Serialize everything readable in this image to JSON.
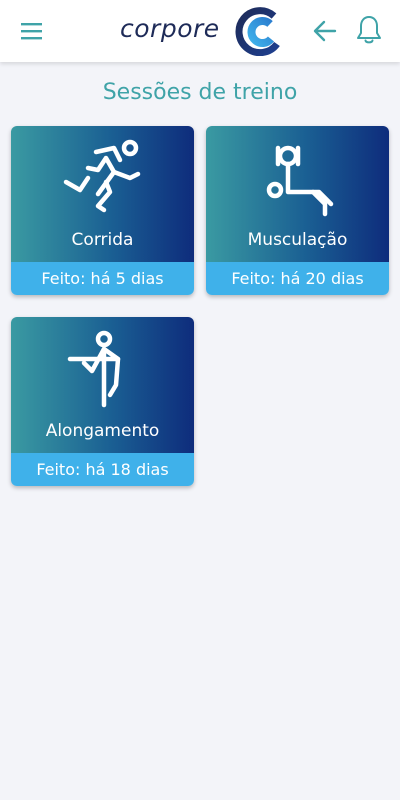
{
  "header": {
    "logo_text": "corpore",
    "menu_icon": "hamburger-menu-icon",
    "back_icon": "arrow-left-icon",
    "notification_icon": "bell-icon"
  },
  "colors": {
    "accent": "#3fa3a8",
    "brand_dark": "#1e2b58",
    "card_gradient_start": "#3a9aa2",
    "card_gradient_end": "#0e2c7c",
    "status_bar": "#3fb1ea",
    "background": "#f3f4f9"
  },
  "page": {
    "title": "Sessões de treino"
  },
  "sessions": [
    {
      "name": "Corrida",
      "status": "Feito: há 5 dias",
      "icon": "running-icon"
    },
    {
      "name": "Musculação",
      "status": "Feito: há 20 dias",
      "icon": "weightlifting-icon"
    },
    {
      "name": "Alongamento",
      "status": "Feito: há 18 dias",
      "icon": "stretching-icon"
    }
  ]
}
